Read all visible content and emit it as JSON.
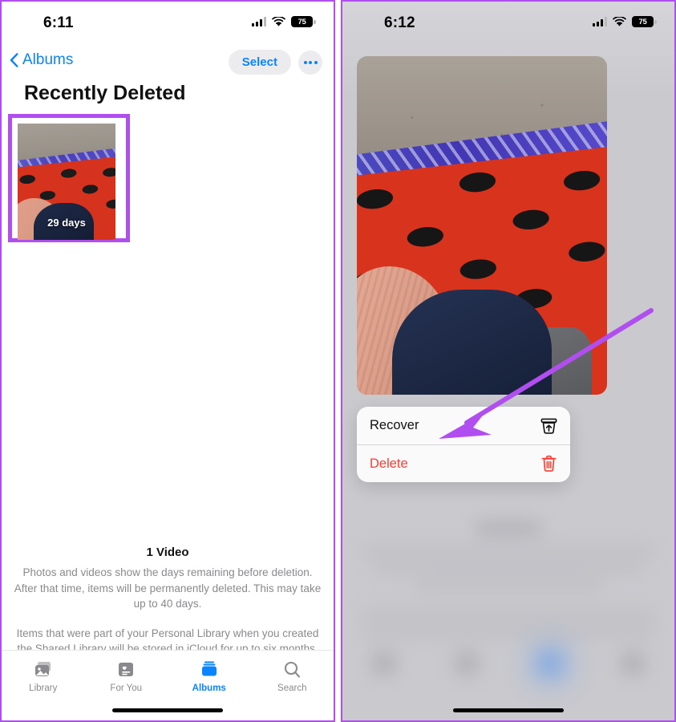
{
  "left_panel": {
    "status_bar": {
      "time": "6:11",
      "battery_level": "75",
      "signal_icon": "cellular-bars-icon",
      "wifi_icon": "wifi-icon",
      "battery_icon": "battery-icon"
    },
    "nav": {
      "back_label": "Albums",
      "back_icon": "chevron-left-icon",
      "select_label": "Select",
      "more_icon": "ellipsis-icon"
    },
    "page_title": "Recently Deleted",
    "thumbnail": {
      "days_label": "29 days",
      "highlight_color": "#b14ef0"
    },
    "footer": {
      "count": "1 Video",
      "paragraph_1": "Photos and videos show the days remaining before deletion. After that time, items will be permanently deleted. This may take up to 40 days.",
      "paragraph_2": "Items that were part of your Personal Library when you created the Shared Library will be stored in iCloud for up to six months."
    },
    "tabs": [
      {
        "label": "Library",
        "icon": "photos-library-icon",
        "active": false
      },
      {
        "label": "For You",
        "icon": "for-you-heart-icon",
        "active": false
      },
      {
        "label": "Albums",
        "icon": "albums-icon",
        "active": true
      },
      {
        "label": "Search",
        "icon": "search-icon",
        "active": false
      }
    ]
  },
  "right_panel": {
    "status_bar": {
      "time": "6:12",
      "battery_level": "75",
      "signal_icon": "cellular-bars-icon",
      "wifi_icon": "wifi-icon",
      "battery_icon": "battery-icon"
    },
    "action_sheet": [
      {
        "label": "Recover",
        "icon": "trash-arrow-up-icon",
        "style": "default"
      },
      {
        "label": "Delete",
        "icon": "trash-icon",
        "style": "destructive"
      }
    ],
    "annotation": {
      "type": "arrow",
      "color": "#b14ef0",
      "points_to": "Recover"
    }
  },
  "accent_colors": {
    "ios_blue": "#0a84ff",
    "destructive_red": "#ff3b30",
    "annotation_purple": "#b14ef0"
  }
}
